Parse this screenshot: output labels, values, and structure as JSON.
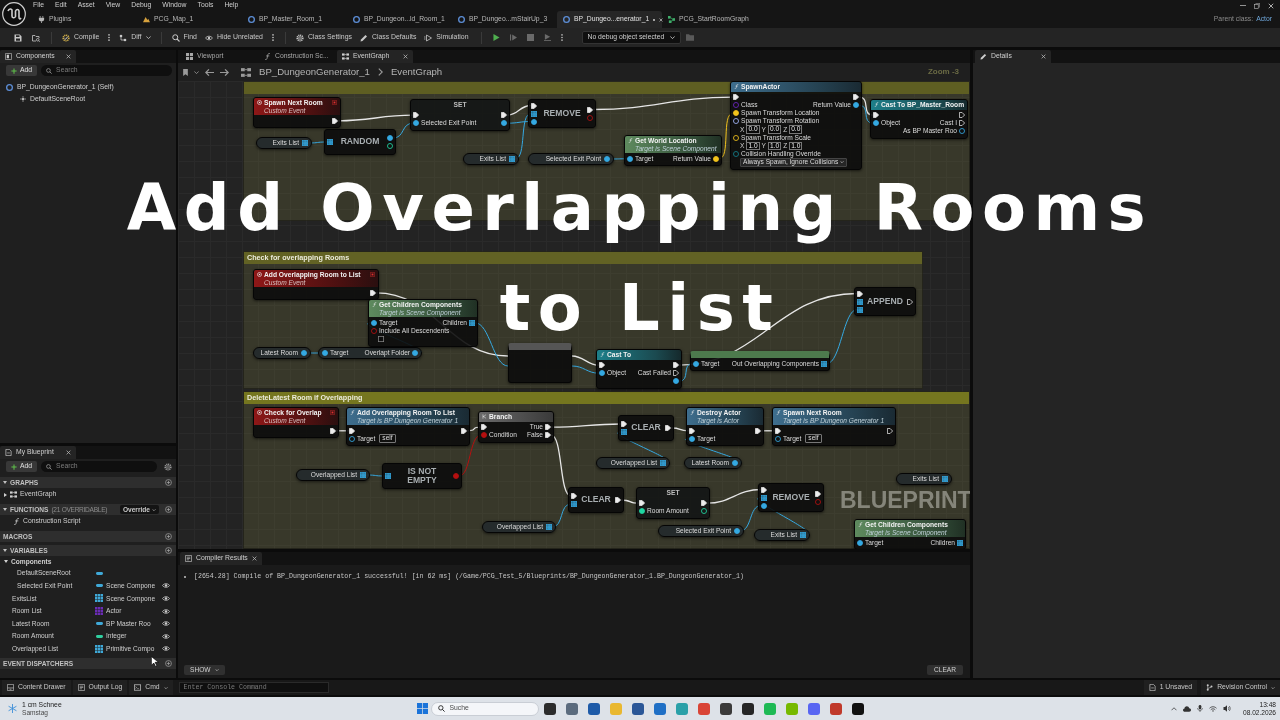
{
  "title_bar": {
    "menu": [
      "File",
      "Edit",
      "Asset",
      "View",
      "Debug",
      "Window",
      "Tools",
      "Help"
    ],
    "parent_class_label": "Parent class:",
    "parent_class": "Actor"
  },
  "document_tabs": [
    {
      "label": "Plugins",
      "kind": "plugin",
      "selected": false,
      "modified": false
    },
    {
      "label": "PCG_Map_1",
      "kind": "level",
      "selected": false,
      "modified": false
    },
    {
      "label": "BP_Master_Room_1",
      "kind": "blueprint",
      "selected": false,
      "modified": false
    },
    {
      "label": "BP_Dungeon...ld_Room_1",
      "kind": "blueprint",
      "selected": false,
      "modified": false
    },
    {
      "label": "BP_Dungeo...mStairUp_3",
      "kind": "blueprint",
      "selected": false,
      "modified": false
    },
    {
      "label": "BP_Dungeo...enerator_1",
      "kind": "blueprint",
      "selected": true,
      "modified": true
    },
    {
      "label": "PCG_StartRoomGraph",
      "kind": "pcg_graph",
      "selected": false,
      "modified": false
    }
  ],
  "toolbar": {
    "groups": [
      {
        "items": [
          {
            "kind": "save"
          },
          {
            "kind": "browse"
          }
        ]
      },
      {
        "items": [
          {
            "kind": "compile",
            "label": "Compile",
            "kebab": true
          },
          {
            "kind": "diff",
            "label": "Diff",
            "dropdown": true
          }
        ]
      },
      {
        "items": [
          {
            "kind": "find",
            "label": "Find"
          },
          {
            "kind": "hide_unrelated",
            "label": "Hide Unrelated",
            "kebab": true
          }
        ]
      },
      {
        "items": [
          {
            "kind": "class_settings",
            "label": "Class Settings"
          },
          {
            "kind": "class_defaults",
            "label": "Class Defaults"
          },
          {
            "kind": "simulation",
            "label": "Simulation"
          }
        ]
      }
    ],
    "play_controls": [
      {
        "kind": "play",
        "disabled": false
      },
      {
        "kind": "step",
        "disabled": true
      },
      {
        "kind": "stop",
        "disabled": true
      },
      {
        "kind": "play_line",
        "disabled": true
      },
      {
        "kind": "more"
      }
    ],
    "debug_object": "No debug object selected",
    "trailing": [
      {
        "kind": "folder"
      }
    ]
  },
  "components_panel": {
    "tab": "Components",
    "add": "Add",
    "search_placeholder": "Search",
    "tree": [
      {
        "label": "BP_DungeonGenerator_1 (Self)",
        "children": [
          {
            "label": "DefaultSceneRoot"
          }
        ]
      }
    ]
  },
  "graph_panel": {
    "tabs": [
      {
        "label": "Viewport",
        "kind": "viewport",
        "selected": false
      },
      {
        "label": "Construction Sc...",
        "kind": "function",
        "selected": false
      },
      {
        "label": "EventGraph",
        "kind": "graph",
        "selected": true
      }
    ],
    "breadcrumb": [
      "BP_DungeonGenerator_1",
      "EventGraph"
    ],
    "zoom": "Zoom -3",
    "graph_label": "BLUEPRINT",
    "comments": [
      {
        "color": "#5e5e22"
      },
      {
        "title": "Check for overlapping Rooms",
        "color": "#626224"
      },
      {
        "title": "DeleteLatest Room if Overlapping",
        "color": "#75761f"
      }
    ],
    "nodes": [
      {
        "kind": "event",
        "title": "Spawn Next Room",
        "subtitle": "Custom Event",
        "outputs": [
          {
            "kind": "exec",
            "linked": true
          }
        ]
      },
      {
        "kind": "getter",
        "title": "Exits List",
        "outputs": [
          {
            "kind": "array",
            "linked": true
          }
        ]
      },
      {
        "kind": "compact",
        "title": "RANDOM",
        "inputs": [
          {
            "kind": "array",
            "linked": true
          }
        ],
        "outputs": [
          {
            "kind": "object",
            "linked": true
          },
          {
            "kind": "int",
            "linked": false
          }
        ]
      },
      {
        "kind": "set",
        "title": "SET",
        "inputs": [
          {
            "kind": "exec",
            "linked": true
          },
          {
            "kind": "object",
            "label": "Selected Exit Point",
            "linked": true
          }
        ],
        "outputs": [
          {
            "kind": "exec",
            "linked": true
          },
          {
            "kind": "object",
            "linked": true
          }
        ]
      },
      {
        "kind": "compact",
        "title": "REMOVE",
        "inputs": [
          {
            "kind": "exec",
            "linked": true
          },
          {
            "kind": "array",
            "linked": true
          },
          {
            "kind": "object",
            "linked": true
          }
        ],
        "outputs": [
          {
            "kind": "exec",
            "linked": true
          },
          {
            "kind": "bool",
            "linked": false
          }
        ]
      },
      {
        "kind": "getter",
        "title": "Exits List",
        "outputs": [
          {
            "kind": "array",
            "linked": true
          }
        ]
      },
      {
        "kind": "getter",
        "title": "Selected Exit Point",
        "outputs": [
          {
            "kind": "object",
            "linked": true
          }
        ]
      },
      {
        "kind": "pure",
        "title": "Get World Location",
        "subtitle": "Target is Scene Component",
        "inputs": [
          {
            "kind": "object",
            "label": "Target",
            "linked": true
          }
        ],
        "outputs": [
          {
            "kind": "vector",
            "label": "Return Value",
            "linked": true
          }
        ]
      },
      {
        "kind": "function",
        "title": "SpawnActor",
        "inputs": [
          {
            "kind": "exec",
            "linked": true
          },
          {
            "kind": "class",
            "label": "Class",
            "linked": false
          },
          {
            "kind": "vector",
            "label": "Spawn Transform Location",
            "linked": true
          },
          {
            "kind": "rotator",
            "label": "Spawn Transform Rotation",
            "linked": false,
            "fields": [
              {
                "axis": "X",
                "value": "0.0"
              },
              {
                "axis": "Y",
                "value": "0.0"
              },
              {
                "axis": "Z",
                "value": "0.0"
              }
            ]
          },
          {
            "kind": "vector",
            "label": "Spawn Transform Scale",
            "linked": false,
            "fields": [
              {
                "axis": "X",
                "value": "1.0"
              },
              {
                "axis": "Y",
                "value": "1.0"
              },
              {
                "axis": "Z",
                "value": "1.0"
              }
            ]
          },
          {
            "kind": "enum",
            "label": "Collision Handling Override",
            "linked": false,
            "option": "Always Spawn, Ignore Collisions"
          }
        ],
        "outputs": [
          {
            "kind": "exec",
            "linked": true
          },
          {
            "kind": "object",
            "label": "Return Value",
            "linked": true
          }
        ]
      },
      {
        "kind": "cast",
        "title": "Cast To BP_Master_Room",
        "inputs": [
          {
            "kind": "exec",
            "linked": true
          },
          {
            "kind": "object",
            "label": "Object",
            "linked": true
          }
        ],
        "outputs": [
          {
            "kind": "exec",
            "linked": false
          },
          {
            "kind": "exec",
            "label": "Cast I",
            "linked": false
          },
          {
            "kind": "object",
            "label": "As BP Master Roo",
            "linked": false
          }
        ]
      },
      {
        "kind": "event",
        "title": "Add Overlapping Room to List",
        "subtitle": "Custom Event",
        "outputs": [
          {
            "kind": "exec",
            "linked": true
          }
        ]
      },
      {
        "kind": "getter",
        "title": "Latest Room",
        "outputs": [
          {
            "kind": "object",
            "linked": true
          }
        ]
      },
      {
        "kind": "member",
        "inputs": [
          {
            "kind": "object",
            "label": "Target",
            "linked": true
          }
        ],
        "outputs": [
          {
            "kind": "object",
            "label": "Overlapt Folder",
            "linked": true
          }
        ]
      },
      {
        "kind": "pure",
        "title": "Get Children Components",
        "subtitle": "Target is Scene Component",
        "inputs": [
          {
            "kind": "object",
            "label": "Target",
            "linked": true
          },
          {
            "kind": "bool",
            "label": "Include All Descendents",
            "linked": false,
            "checked": false
          }
        ],
        "outputs": [
          {
            "kind": "array",
            "label": "Children",
            "linked": true
          }
        ]
      },
      {
        "kind": "loop"
      },
      {
        "kind": "cast",
        "title": "Cast To",
        "inputs": [
          {
            "kind": "exec",
            "linked": true
          },
          {
            "kind": "object",
            "label": "Object",
            "linked": true
          }
        ],
        "outputs": [
          {
            "kind": "exec",
            "linked": true
          },
          {
            "kind": "exec",
            "label": "Cast Failed",
            "linked": false
          },
          {
            "kind": "object",
            "linked": true
          }
        ]
      },
      {
        "kind": "pure",
        "inputs": [
          {
            "kind": "object",
            "label": "Target",
            "linked": true
          }
        ],
        "outputs": [
          {
            "kind": "array",
            "label": "Out Overlapping Components",
            "linked": true
          }
        ]
      },
      {
        "kind": "compact",
        "title": "APPEND",
        "inputs": [
          {
            "kind": "exec",
            "linked": true
          },
          {
            "kind": "array",
            "linked": true
          },
          {
            "kind": "array",
            "linked": true
          }
        ],
        "outputs": [
          {
            "kind": "exec",
            "linked": false
          }
        ]
      },
      {
        "kind": "event",
        "title": "Check for Overlap",
        "subtitle": "Custom Event",
        "outputs": [
          {
            "kind": "exec",
            "linked": true
          }
        ]
      },
      {
        "kind": "function",
        "title": "Add Overlapping Room To List",
        "subtitle": "Target is BP Dungeon Generator 1",
        "inputs": [
          {
            "kind": "exec",
            "linked": true
          },
          {
            "kind": "object",
            "label": "Target",
            "linked": false,
            "value": "self"
          }
        ],
        "outputs": [
          {
            "kind": "exec",
            "linked": true
          }
        ]
      },
      {
        "kind": "branch",
        "title": "Branch",
        "inputs": [
          {
            "kind": "exec",
            "linked": true
          },
          {
            "kind": "bool",
            "label": "Condition",
            "linked": true
          }
        ],
        "outputs": [
          {
            "kind": "exec",
            "label": "True",
            "linked": true
          },
          {
            "kind": "exec",
            "label": "False",
            "linked": true
          }
        ]
      },
      {
        "kind": "getter",
        "title": "Overlapped List",
        "outputs": [
          {
            "kind": "array",
            "linked": true
          }
        ]
      },
      {
        "kind": "compact",
        "title": "IS NOT EMPTY",
        "inputs": [
          {
            "kind": "array",
            "linked": true
          }
        ],
        "outputs": [
          {
            "kind": "bool",
            "linked": true
          }
        ]
      },
      {
        "kind": "compact",
        "title": "CLEAR",
        "inputs": [
          {
            "kind": "exec",
            "linked": true
          },
          {
            "kind": "array",
            "linked": true
          }
        ],
        "outputs": [
          {
            "kind": "exec",
            "linked": true
          }
        ]
      },
      {
        "kind": "getter",
        "title": "Overlapped List",
        "outputs": [
          {
            "kind": "array",
            "linked": true
          }
        ]
      },
      {
        "kind": "function",
        "title": "Destroy Actor",
        "subtitle": "Target is Actor",
        "inputs": [
          {
            "kind": "exec",
            "linked": true
          },
          {
            "kind": "object",
            "label": "Target",
            "linked": true
          }
        ],
        "outputs": [
          {
            "kind": "exec",
            "linked": true
          }
        ]
      },
      {
        "kind": "getter",
        "title": "Latest Room",
        "outputs": [
          {
            "kind": "object",
            "linked": true
          }
        ]
      },
      {
        "kind": "function",
        "title": "Spawn Next Room",
        "subtitle": "Target is BP Dungeon Generator 1",
        "inputs": [
          {
            "kind": "exec",
            "linked": true
          },
          {
            "kind": "object",
            "label": "Target",
            "linked": false,
            "value": "self"
          }
        ],
        "outputs": [
          {
            "kind": "exec",
            "linked": false
          }
        ]
      },
      {
        "kind": "compact",
        "title": "CLEAR",
        "inputs": [
          {
            "kind": "exec",
            "linked": true
          },
          {
            "kind": "array",
            "linked": true
          }
        ],
        "outputs": [
          {
            "kind": "exec",
            "linked": true
          }
        ]
      },
      {
        "kind": "getter",
        "title": "Overlapped List",
        "outputs": [
          {
            "kind": "array",
            "linked": true
          }
        ]
      },
      {
        "kind": "set",
        "title": "SET",
        "inputs": [
          {
            "kind": "exec",
            "linked": true
          },
          {
            "kind": "int",
            "label": "Room Amount",
            "linked": true
          }
        ],
        "outputs": [
          {
            "kind": "exec",
            "linked": true
          },
          {
            "kind": "int",
            "linked": false
          }
        ]
      },
      {
        "kind": "compact",
        "title": "REMOVE",
        "inputs": [
          {
            "kind": "exec",
            "linked": true
          },
          {
            "kind": "array",
            "linked": true
          },
          {
            "kind": "object",
            "linked": true
          }
        ],
        "outputs": [
          {
            "kind": "exec",
            "linked": true
          },
          {
            "kind": "bool",
            "linked": false
          }
        ]
      },
      {
        "kind": "getter",
        "title": "Selected Exit Point",
        "outputs": [
          {
            "kind": "object",
            "linked": true
          }
        ]
      },
      {
        "kind": "getter",
        "title": "Exits List",
        "outputs": [
          {
            "kind": "array",
            "linked": true
          }
        ]
      },
      {
        "kind": "getter",
        "title": "Exits List",
        "outputs": [
          {
            "kind": "array",
            "linked": true
          }
        ]
      },
      {
        "kind": "pure",
        "title": "Get Children Components",
        "subtitle": "Target is Scene Component",
        "inputs": [
          {
            "kind": "object",
            "label": "Target",
            "linked": true
          }
        ],
        "outputs": [
          {
            "kind": "array",
            "label": "Children",
            "linked": true
          }
        ]
      }
    ]
  },
  "details_panel": {
    "tab": "Details"
  },
  "overlay_title": [
    "Add Overlapping Rooms",
    "to List"
  ],
  "my_blueprint": {
    "tab": "My Blueprint",
    "add": "Add",
    "search_placeholder": "Search",
    "sections": [
      {
        "title": "GRAPHS",
        "expanded": true,
        "items": [
          {
            "label": "EventGraph",
            "kind": "graph",
            "expanded": false
          }
        ]
      },
      {
        "title": "FUNCTIONS",
        "note": "(21 OVERRIDABLE)",
        "menu": "Override",
        "expanded": true,
        "items": [
          {
            "label": "Construction Script",
            "kind": "function"
          }
        ]
      },
      {
        "title": "MACROS",
        "expanded": false
      },
      {
        "title": "VARIABLES",
        "expanded": true,
        "categories": [
          {
            "label": "Components",
            "expanded": true,
            "variables": [
              {
                "name": "DefaultSceneRoot",
                "kind": "single",
                "color": "#3fa9d8",
                "public": false
              },
              {
                "name": "Selected Exit Point",
                "type": "Scene Compone",
                "kind": "single",
                "color": "#3fa9d8",
                "public": true
              }
            ]
          }
        ],
        "variables": [
          {
            "name": "ExitsList",
            "type": "Scene Compone",
            "kind": "array",
            "color": "#3fa9d8",
            "public": true
          },
          {
            "name": "Room List",
            "type": "Actor",
            "kind": "array",
            "color": "#6a2cb4",
            "public": true
          },
          {
            "name": "Latest Room",
            "type": "BP Master Roo",
            "kind": "single",
            "color": "#3fa9d8",
            "public": true
          },
          {
            "name": "Room Amount",
            "type": "Integer",
            "kind": "single",
            "color": "#30cfa0",
            "public": true
          },
          {
            "name": "Overlapped List",
            "type": "Primitive Compo",
            "kind": "array",
            "color": "#3fa9d8",
            "public": true
          }
        ]
      },
      {
        "title": "EVENT DISPATCHERS",
        "expanded": false
      }
    ]
  },
  "compiler_panel": {
    "tab": "Compiler Results",
    "messages": [
      "[2654.28] Compile of BP_DungeonGenerator_1 successful! [in 62 ms] (/Game/PCG_Test_5/Blueprints/BP_DungeonGenerator_1.BP_DungeonGenerator_1)"
    ],
    "show": "SHOW",
    "clear": "CLEAR"
  },
  "status_bar": {
    "left": [
      {
        "kind": "content_drawer",
        "label": "Content Drawer"
      },
      {
        "kind": "output_log",
        "label": "Output Log"
      },
      {
        "kind": "cmd",
        "label": "Cmd",
        "dropdown": true
      }
    ],
    "console_placeholder": "Enter Console Command",
    "right": [
      {
        "kind": "unsaved",
        "label": "1 Unsaved"
      },
      {
        "kind": "revision_control",
        "label": "Revision Control",
        "dropdown": true
      }
    ]
  },
  "taskbar": {
    "weather": {
      "text": "1 cm Schnee",
      "day": "Samstag"
    },
    "search_placeholder": "Suche",
    "apps": [
      {
        "color": "#2b2b2b"
      },
      {
        "color": "#5b6b7d"
      },
      {
        "color": "#1e5ba8"
      },
      {
        "color": "#e9b830"
      },
      {
        "color": "#2b5797"
      },
      {
        "color": "#1f6fc5"
      },
      {
        "color": "#2aa0a8"
      },
      {
        "color": "#d94436"
      },
      {
        "color": "#3a3a3a"
      },
      {
        "color": "#262626"
      },
      {
        "color": "#1db954"
      },
      {
        "color": "#76b900"
      },
      {
        "color": "#5865f2"
      },
      {
        "color": "#c0392b"
      },
      {
        "color": "#111111"
      }
    ],
    "time": "13:48",
    "date": "08.02.2026"
  }
}
